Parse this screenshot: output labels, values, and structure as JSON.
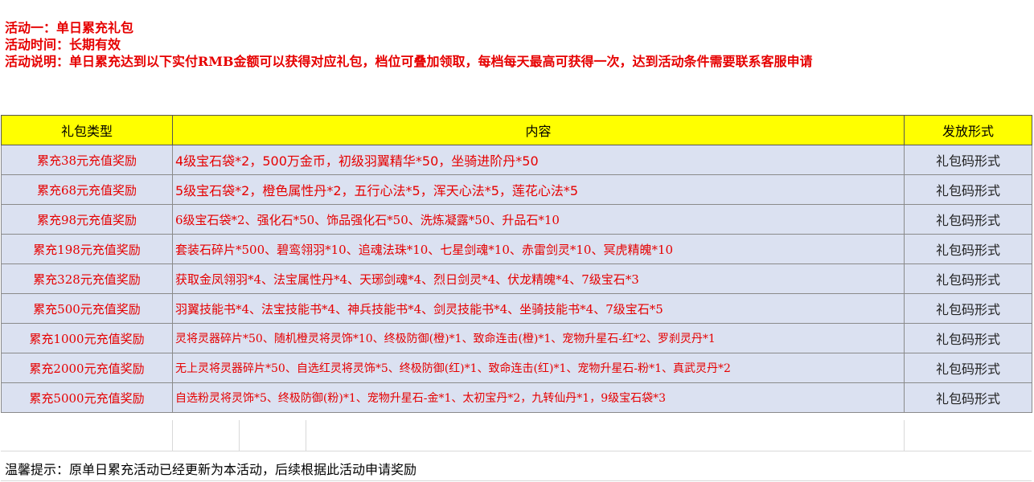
{
  "header": {
    "line1": "活动一：单日累充礼包",
    "line2": "活动时间：长期有效",
    "line3": "活动说明：单日累充达到以下实付RMB金额可以获得对应礼包，档位可叠加领取，每档每天最高可获得一次，达到活动条件需要联系客服申请"
  },
  "table": {
    "headers": [
      "礼包类型",
      "内容",
      "发放形式"
    ],
    "rows": [
      {
        "type": "累充38元充值奖励",
        "content": "4级宝石袋*2，500万金币，初级羽翼精华*50，坐骑进阶丹*50",
        "delivery": "礼包码形式"
      },
      {
        "type": "累充68元充值奖励",
        "content": "5级宝石袋*2，橙色属性丹*2，五行心法*5，浑天心法*5，莲花心法*5",
        "delivery": "礼包码形式"
      },
      {
        "type": "累充98元充值奖励",
        "content": "6级宝石袋*2、强化石*50、饰品强化石*50、洗炼凝露*50、升品石*10",
        "delivery": "礼包码形式"
      },
      {
        "type": "累充198元充值奖励",
        "content": "套装石碎片*500、碧鸾翎羽*10、追魂法珠*10、七星剑魂*10、赤雷剑灵*10、冥虎精魄*10",
        "delivery": "礼包码形式"
      },
      {
        "type": "累充328元充值奖励",
        "content": "获取金凤翎羽*4、法宝属性丹*4、天琊剑魂*4、烈日剑灵*4、伏龙精魄*4、7级宝石*3",
        "delivery": "礼包码形式"
      },
      {
        "type": "累充500元充值奖励",
        "content": "羽翼技能书*4、法宝技能书*4、神兵技能书*4、剑灵技能书*4、坐骑技能书*4、7级宝石*5",
        "delivery": "礼包码形式"
      },
      {
        "type": "累充1000元充值奖励",
        "content": "灵将灵器碎片*50、随机橙灵将灵饰*10、终极防御(橙)*1、致命连击(橙)*1、宠物升星石-红*2、罗刹灵丹*1",
        "delivery": "礼包码形式"
      },
      {
        "type": "累充2000元充值奖励",
        "content": "无上灵将灵器碎片*50、自选红灵将灵饰*5、终极防御(红)*1、致命连击(红)*1、宠物升星石-粉*1、真武灵丹*2",
        "delivery": "礼包码形式"
      },
      {
        "type": "累充5000元充值奖励",
        "content": "自选粉灵将灵饰*5、终极防御(粉)*1、宠物升星石-金*1、太初宝丹*2，九转仙丹*1，9级宝石袋*3",
        "delivery": "礼包码形式"
      }
    ]
  },
  "tip": "温馨提示：原单日累充活动已经更新为本活动，后续根据此活动申请奖励",
  "colors": {
    "accent_red": "#e60000",
    "header_yellow": "#ffff00",
    "row_blue": "#dbe1f1"
  }
}
